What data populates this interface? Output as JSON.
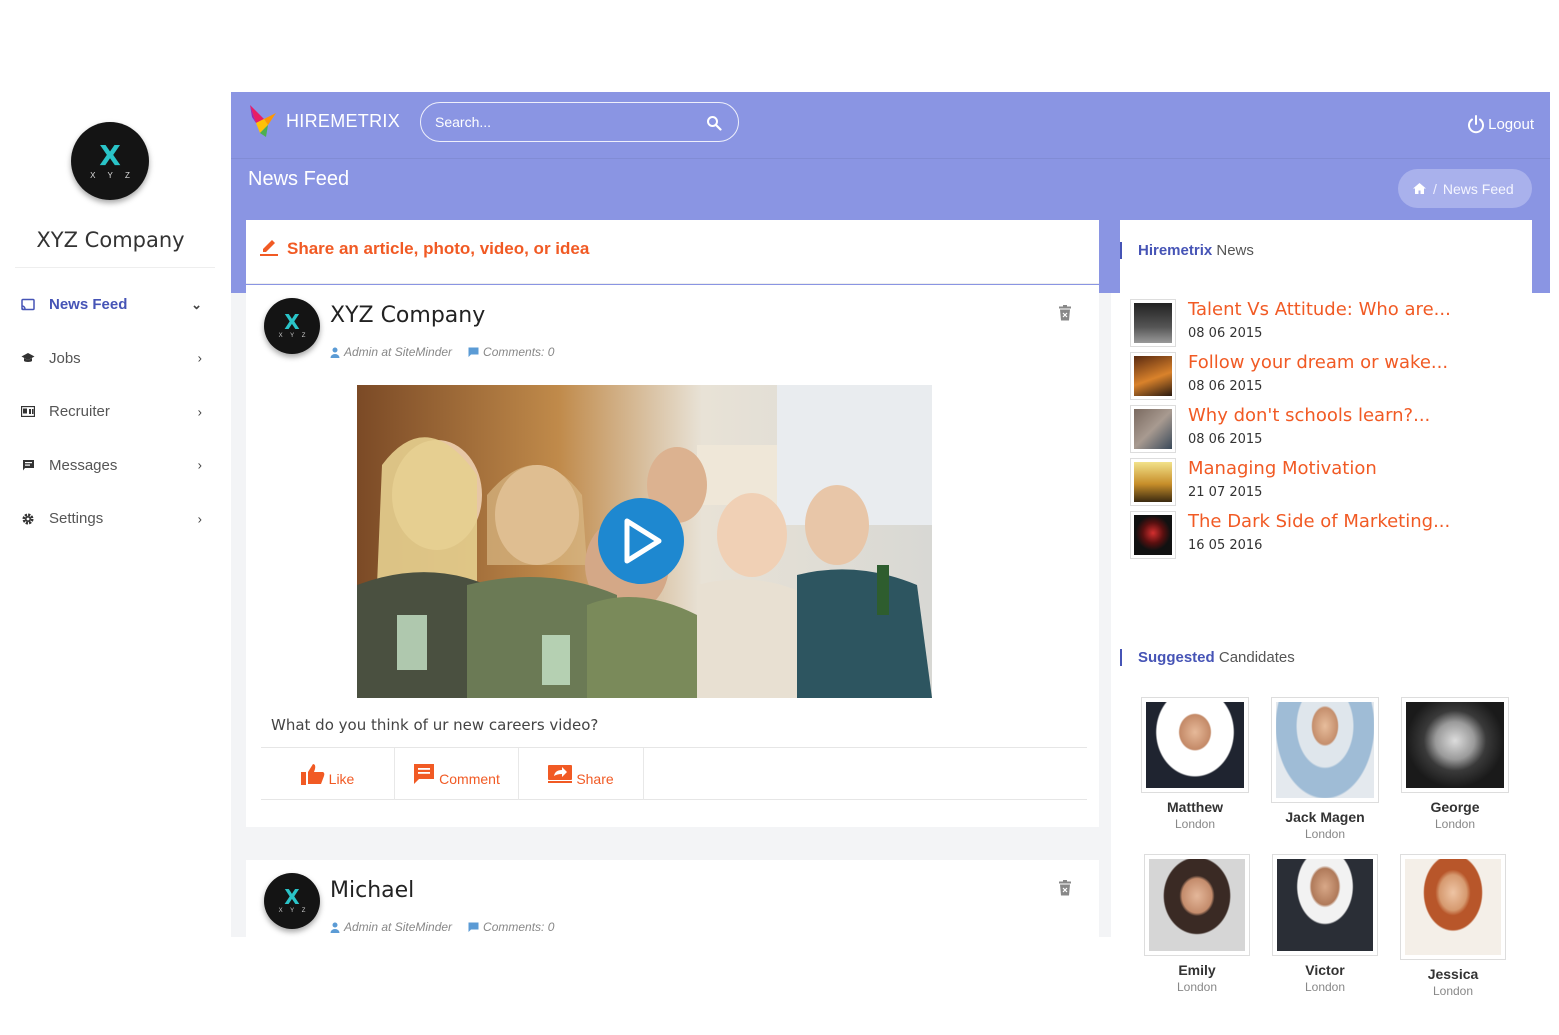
{
  "sidebar": {
    "company_name": "XYZ Company",
    "logo_glyph": "X",
    "logo_text": "X Y Z",
    "items": [
      {
        "label": "News Feed",
        "icon": "cast-icon",
        "active": true
      },
      {
        "label": "Jobs",
        "icon": "graduation-cap-icon"
      },
      {
        "label": "Recruiter",
        "icon": "id-card-icon"
      },
      {
        "label": "Messages",
        "icon": "message-icon"
      },
      {
        "label": "Settings",
        "icon": "gear-icon"
      }
    ]
  },
  "header": {
    "brand": "HIREMETRIX",
    "search_placeholder": "Search...",
    "logout_label": "Logout",
    "page_title": "News Feed",
    "breadcrumb_current": "News Feed",
    "breadcrumb_sep": "/"
  },
  "share": {
    "label": "Share an article, photo, video, or idea"
  },
  "posts": [
    {
      "author": "XYZ Company",
      "meta_author": "Admin at SiteMinder",
      "meta_comments": "Comments: 0",
      "caption": "What do you think of ur new careers video?",
      "actions": {
        "like": "Like",
        "comment": "Comment",
        "share": "Share"
      }
    },
    {
      "author": "Michael",
      "meta_author": "Admin at SiteMinder",
      "meta_comments": "Comments: 0"
    }
  ],
  "news": {
    "title_bold": "Hiremetrix",
    "title_rest": "News",
    "items": [
      {
        "title": "Talent Vs Attitude: Who are...",
        "date": "08 06 2015"
      },
      {
        "title": "Follow your dream or wake...",
        "date": "08 06 2015"
      },
      {
        "title": "Why don't schools learn?...",
        "date": "08 06 2015"
      },
      {
        "title": "Managing Motivation",
        "date": "21 07 2015"
      },
      {
        "title": "The Dark Side of Marketing...",
        "date": "16 05 2016"
      }
    ]
  },
  "candidates": {
    "title_bold": "Suggested",
    "title_rest": "Candidates",
    "items": [
      {
        "name": "Matthew",
        "location": "London"
      },
      {
        "name": "Jack Magen",
        "location": "London"
      },
      {
        "name": "George",
        "location": "London"
      },
      {
        "name": "Emily",
        "location": "London"
      },
      {
        "name": "Victor",
        "location": "London"
      },
      {
        "name": "Jessica",
        "location": "London"
      }
    ]
  },
  "colors": {
    "header": "#8a95e3",
    "accent": "#f15a24",
    "primary": "#4654b6",
    "play_button": "#1e88d0"
  }
}
